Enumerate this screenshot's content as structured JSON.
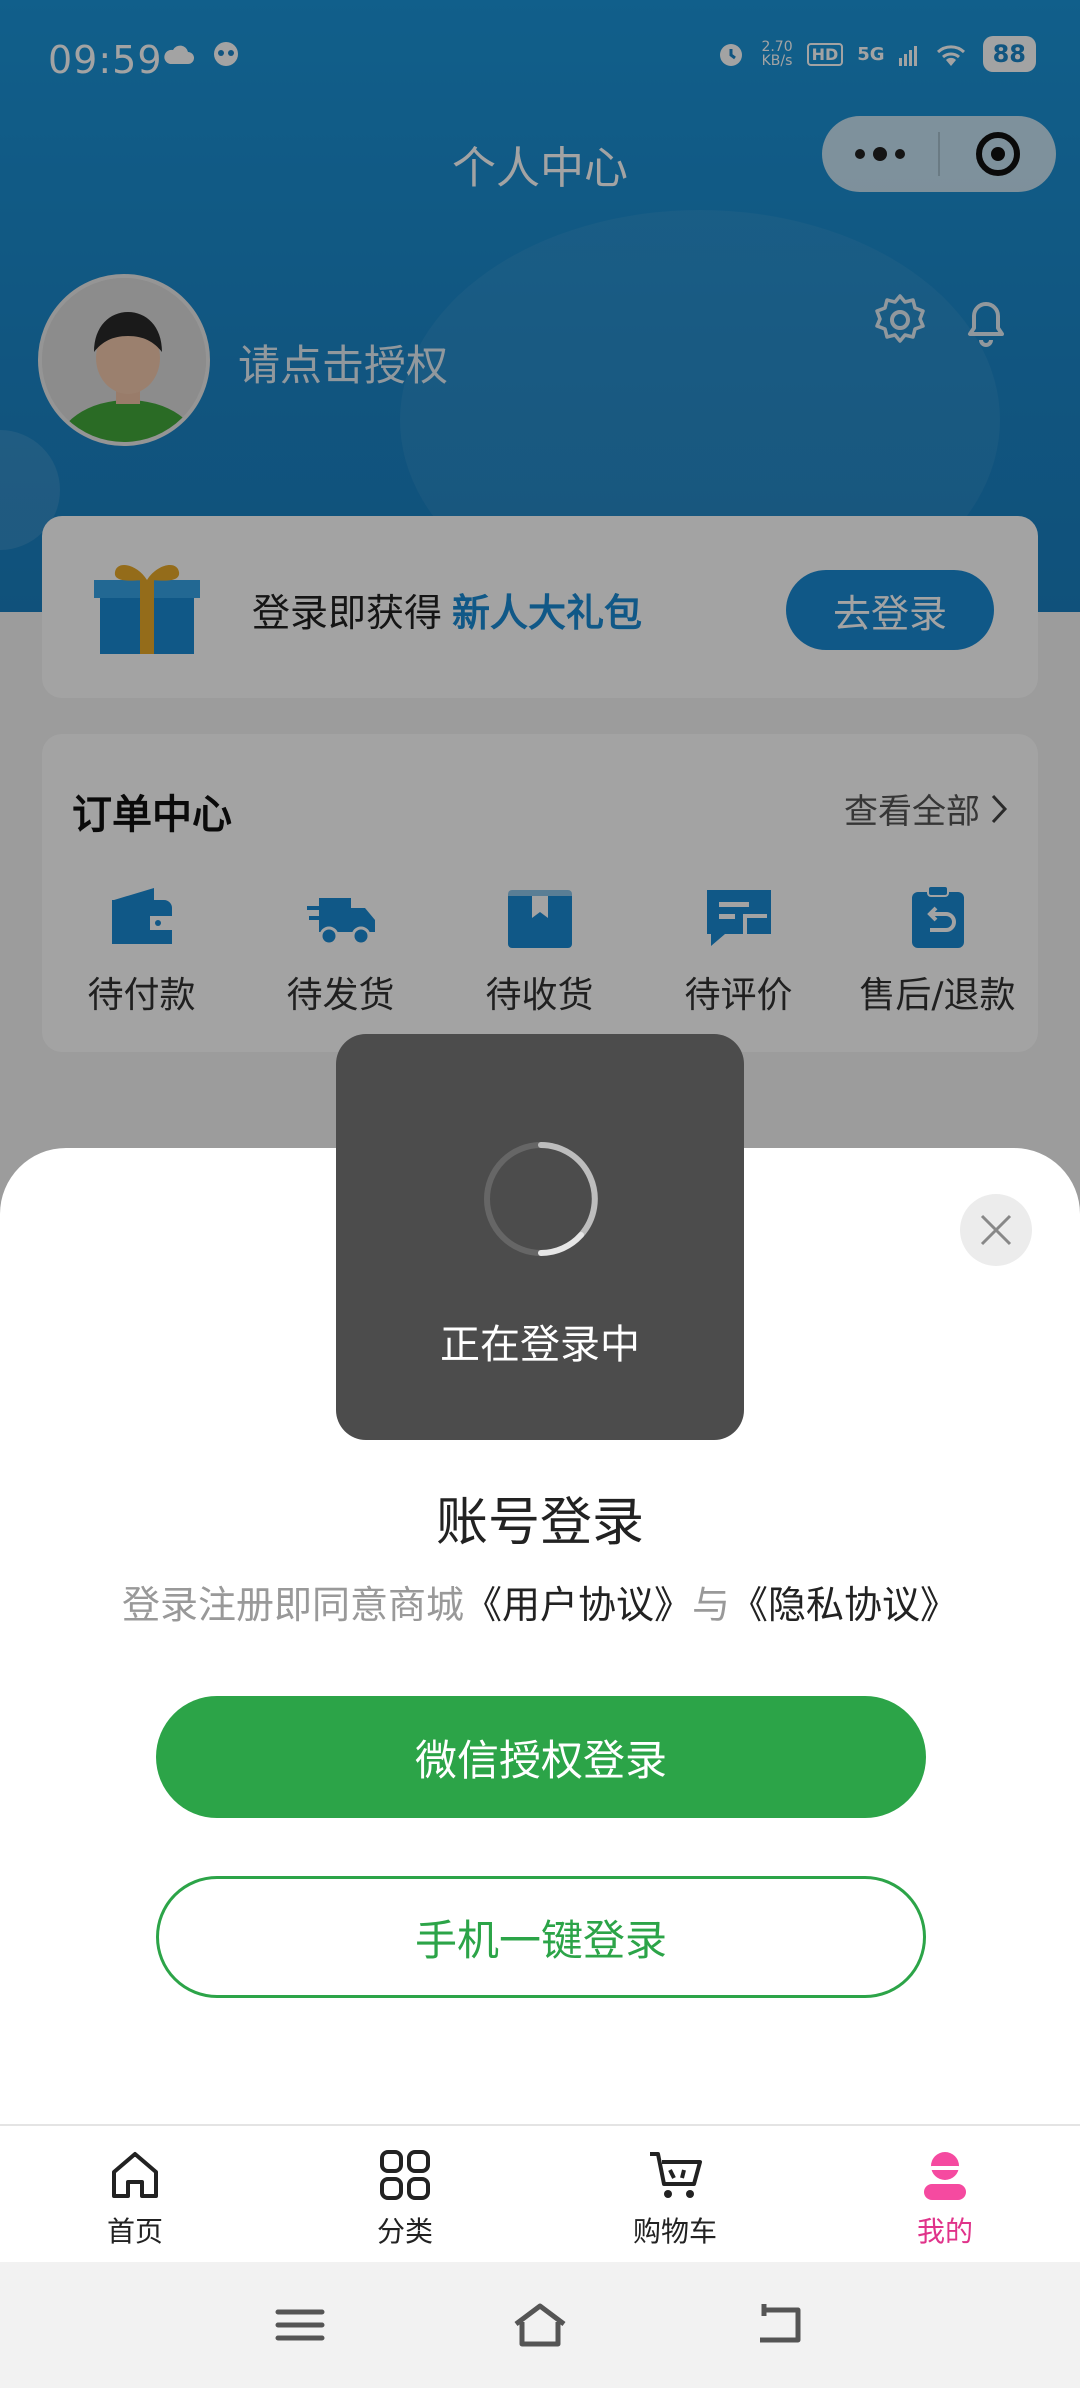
{
  "status_bar": {
    "time": "09:59",
    "speed_value": "2.70",
    "speed_unit": "KB/s",
    "hd": "HD",
    "network": "5G",
    "battery": "88"
  },
  "header": {
    "title": "个人中心",
    "user_prompt": "请点击授权"
  },
  "promo": {
    "text": "登录即获得",
    "highlight": "新人大礼包",
    "button": "去登录"
  },
  "orders": {
    "title": "订单中心",
    "view_all": "查看全部",
    "items": [
      {
        "label": "待付款",
        "icon": "wallet-icon"
      },
      {
        "label": "待发货",
        "icon": "truck-icon"
      },
      {
        "label": "待收货",
        "icon": "package-icon"
      },
      {
        "label": "待评价",
        "icon": "review-icon"
      },
      {
        "label": "售后/退款",
        "icon": "refund-icon"
      }
    ]
  },
  "toast": {
    "text": "正在登录中"
  },
  "login_sheet": {
    "title": "账号登录",
    "agreement_prefix": "登录注册即同意商城",
    "user_agreement": "《用户协议》",
    "and": "与",
    "privacy_agreement": "《隐私协议》",
    "wechat_button": "微信授权登录",
    "phone_button": "手机一键登录"
  },
  "tabbar": {
    "items": [
      {
        "label": "首页",
        "icon": "home-icon"
      },
      {
        "label": "分类",
        "icon": "grid-icon"
      },
      {
        "label": "购物车",
        "icon": "cart-icon"
      },
      {
        "label": "我的",
        "icon": "profile-icon",
        "active": true
      }
    ]
  },
  "colors": {
    "primary_blue": "#1a8ad3",
    "wechat_green": "#2ca448",
    "active_tab_pink": "#e0338a"
  }
}
